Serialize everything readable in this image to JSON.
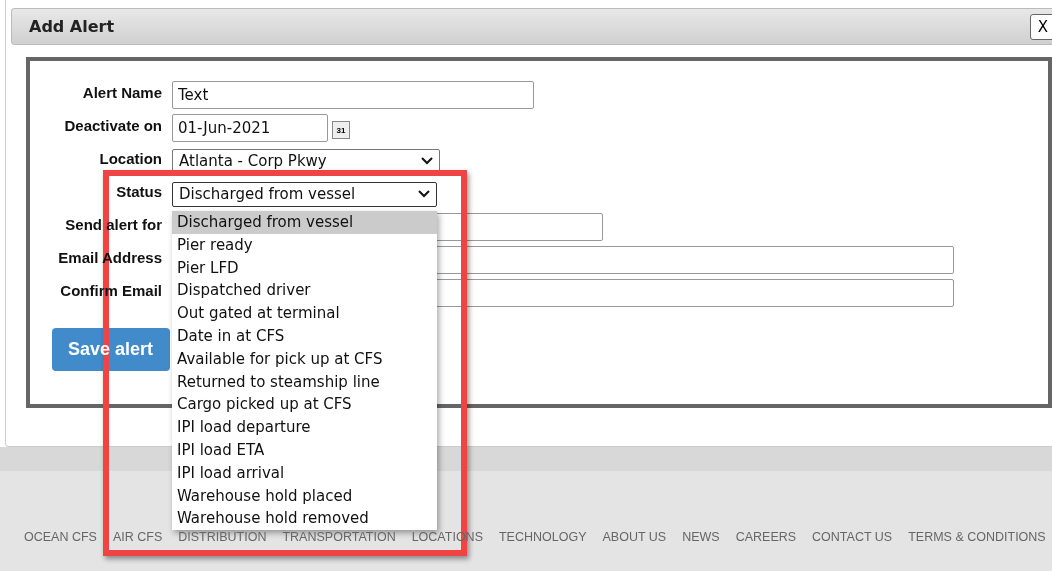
{
  "dialog": {
    "title": "Add Alert",
    "close_label": "X"
  },
  "fields": [
    {
      "kind": "text",
      "label": "Alert Name",
      "value": "Text"
    },
    {
      "kind": "date",
      "label": "Deactivate on",
      "value": "01-Jun-2021",
      "calendar_label": "31"
    },
    {
      "kind": "select",
      "label": "Location",
      "value": "Atlanta - Corp Pkwy",
      "expanded": false
    },
    {
      "kind": "select",
      "label": "Status",
      "value": "Discharged from vessel",
      "expanded": true,
      "options": [
        {
          "label": "Discharged from vessel",
          "selected": true
        },
        {
          "label": "Pier ready",
          "selected": false
        },
        {
          "label": "Pier LFD",
          "selected": false
        },
        {
          "label": "Dispatched driver",
          "selected": false
        },
        {
          "label": "Out gated at terminal",
          "selected": false
        },
        {
          "label": "Date in at CFS",
          "selected": false
        },
        {
          "label": "Available for pick up at CFS",
          "selected": false
        },
        {
          "label": "Returned to steamship line",
          "selected": false
        },
        {
          "label": "Cargo picked up at CFS",
          "selected": false
        },
        {
          "label": "IPI load departure",
          "selected": false
        },
        {
          "label": "IPI load ETA",
          "selected": false
        },
        {
          "label": "IPI load arrival",
          "selected": false
        },
        {
          "label": "Warehouse hold placed",
          "selected": false
        },
        {
          "label": "Warehouse hold removed",
          "selected": false
        }
      ]
    },
    {
      "kind": "text",
      "label": "Send alert for"
    },
    {
      "kind": "text",
      "label": "Email Address"
    },
    {
      "kind": "text",
      "label": "Confirm Email"
    }
  ],
  "save_button": "Save alert",
  "footer_links": [
    "OCEAN CFS",
    "AIR CFS",
    "DISTRIBUTION",
    "TRANSPORTATION",
    "LOCATIONS",
    "TECHNOLOGY",
    "ABOUT US",
    "NEWS",
    "CAREERS",
    "CONTACT US",
    "TERMS & CONDITIONS"
  ]
}
